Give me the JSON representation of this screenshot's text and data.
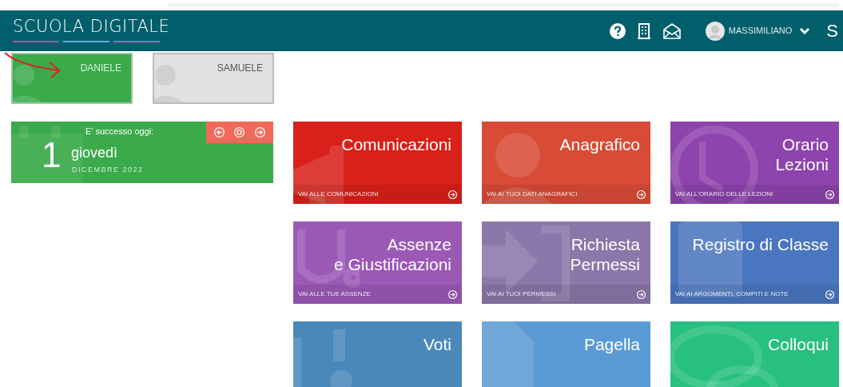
{
  "header": {
    "logo": "SCUOLA DIGITALE",
    "user": "MASSIMILIANO",
    "brand_cut": "S"
  },
  "students": [
    {
      "name": "DANIELE",
      "selected": true
    },
    {
      "name": "SAMUELE",
      "selected": false
    }
  ],
  "calendar": {
    "caption": "E' successo oggi:",
    "day": "1",
    "weekday": "giovedì",
    "month": "DICEMBRE 2022"
  },
  "tiles": [
    {
      "title": "Comunicazioni",
      "link": "VAI ALLE COMUNICAZIONI",
      "color": "#d9201a"
    },
    {
      "title": "Anagrafico",
      "link": "VAI AI TUOI DATI ANAGRAFICI",
      "color": "#d84b37"
    },
    {
      "title": "Orario\nLezioni",
      "link": "VAI ALL'ORARIO DELLE LEZIONI",
      "color": "#8e44ad"
    },
    {
      "title": "Assenze\ne Giustificazioni",
      "link": "VAI ALLE TUE ASSENZE",
      "color": "#9b59b6"
    },
    {
      "title": "Richiesta\nPermessi",
      "link": "VAI AI TUOI PERMESSI",
      "color": "#8b77a9"
    },
    {
      "title": "Registro di Classe",
      "link": "VAI AI ARGOMENTI, COMPITI E NOTE",
      "color": "#4a76bf"
    },
    {
      "title": "Voti",
      "color": "#4a88ba"
    },
    {
      "title": "Pagella",
      "color": "#5b9bd5"
    },
    {
      "title": "Colloqui",
      "color": "#27c07e"
    }
  ]
}
